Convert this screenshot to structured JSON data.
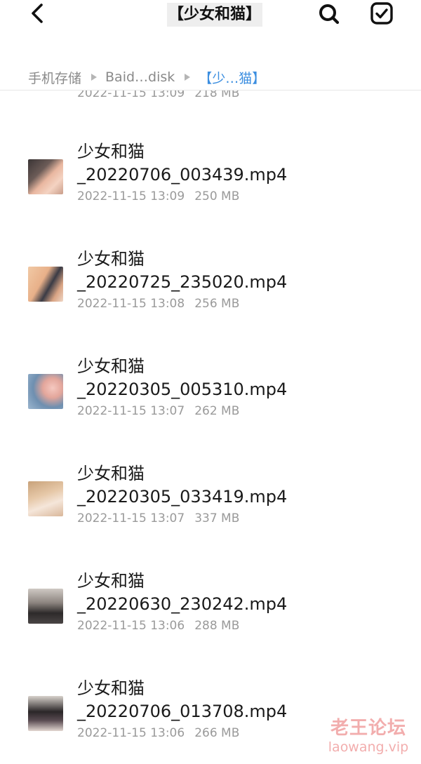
{
  "header": {
    "title": "【少女和猫】",
    "back_icon": "chevron-left-icon",
    "search_icon": "search-icon",
    "select_icon": "checkbox-checked-icon"
  },
  "breadcrumb": {
    "items": [
      "手机存储",
      "Baid…disk",
      "【少…猫】"
    ],
    "active_color": "#3b8ee0"
  },
  "partial_item": {
    "date": "2022-11-15 13:09",
    "size": "218 MB"
  },
  "files": [
    {
      "prefix": "少女和猫",
      "suffix": "_20220706_003439.mp4",
      "date": "2022-11-15 13:09",
      "size": "250 MB"
    },
    {
      "prefix": "少女和猫",
      "suffix": "_20220725_235020.mp4",
      "date": "2022-11-15 13:08",
      "size": "256 MB"
    },
    {
      "prefix": "少女和猫",
      "suffix": "_20220305_005310.mp4",
      "date": "2022-11-15 13:07",
      "size": "262 MB"
    },
    {
      "prefix": "少女和猫",
      "suffix": "_20220305_033419.mp4",
      "date": "2022-11-15 13:07",
      "size": "337 MB"
    },
    {
      "prefix": "少女和猫",
      "suffix": "_20220630_230242.mp4",
      "date": "2022-11-15 13:06",
      "size": "288 MB"
    },
    {
      "prefix": "少女和猫",
      "suffix": "_20220706_013708.mp4",
      "date": "2022-11-15 13:06",
      "size": "266 MB"
    }
  ],
  "watermark": {
    "line1": "老王论坛",
    "line2": "laowang.vip"
  }
}
